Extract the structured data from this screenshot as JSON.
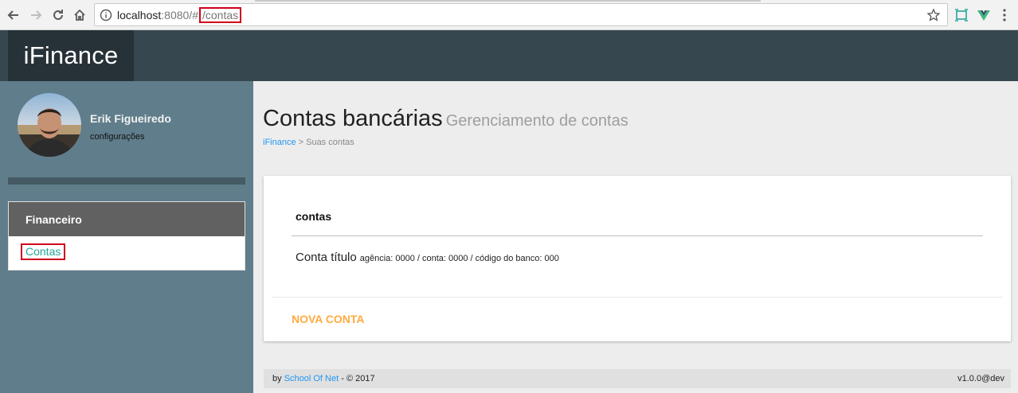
{
  "browser": {
    "url_host": "localhost",
    "url_port": ":8080/",
    "url_hash": "#",
    "url_path": "/contas"
  },
  "app": {
    "brand": "iFinance"
  },
  "sidebar": {
    "user_name": "Erik Figueiredo",
    "user_config": "configurações",
    "menu_header": "Financeiro",
    "menu_item": "Contas"
  },
  "main": {
    "title": "Contas bancárias",
    "subtitle": "Gerenciamento de contas",
    "breadcrumb_link": "iFinance",
    "breadcrumb_rest": " > Suas contas"
  },
  "card": {
    "title": "contas",
    "accounts": [
      {
        "name": "Conta título",
        "meta": "agência: 0000 / conta: 0000 / código do banco: 000"
      }
    ],
    "action_label": "NOVA CONTA"
  },
  "footer": {
    "by": "by ",
    "link": "School Of Net",
    "copy": " - © 2017",
    "version": "v1.0.0@dev"
  }
}
